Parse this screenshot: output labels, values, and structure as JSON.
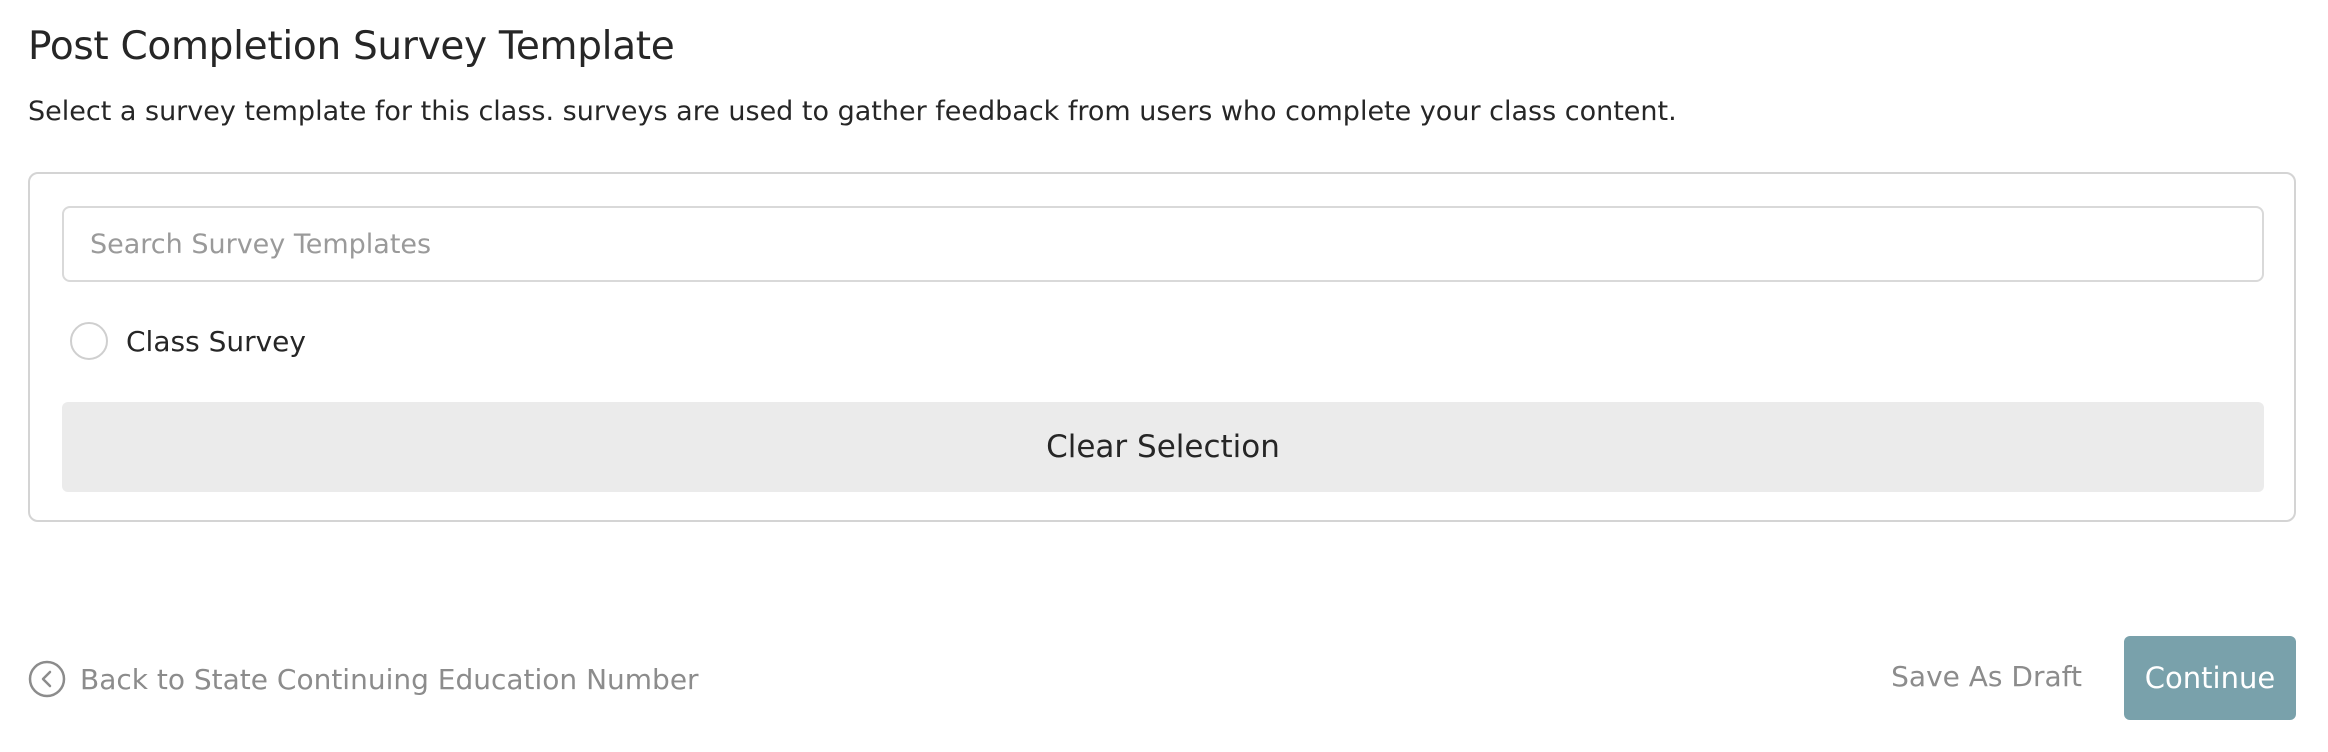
{
  "header": {
    "title": "Post Completion Survey Template",
    "description": "Select a survey template for this class. surveys are used to gather feedback from users who complete your class content."
  },
  "panel": {
    "search": {
      "placeholder": "Search Survey Templates",
      "value": ""
    },
    "options": [
      {
        "label": "Class Survey",
        "selected": false
      }
    ],
    "clear_label": "Clear Selection"
  },
  "footer": {
    "back_label": "Back to State Continuing Education Number",
    "back_icon": "chevron-left-circle-icon",
    "save_draft_label": "Save As Draft",
    "continue_label": "Continue"
  },
  "colors": {
    "continue_bg": "#79a1ab",
    "clear_bg": "#ebebeb",
    "muted_text": "#8c8c8c"
  }
}
